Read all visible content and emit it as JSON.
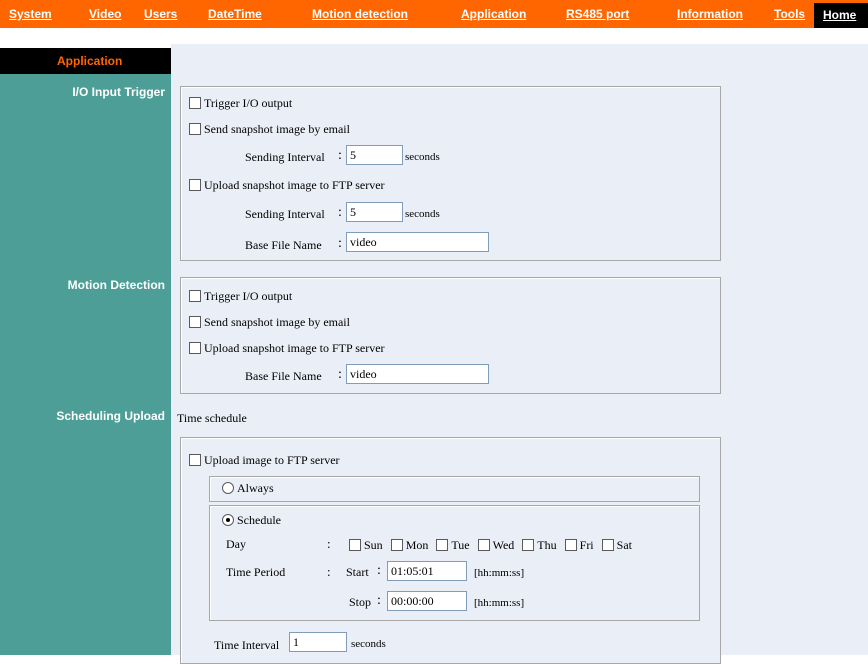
{
  "nav": {
    "items": [
      "System",
      "Video",
      "Users",
      "DateTime",
      "Motion detection",
      "Application",
      "RS485 port",
      "Information",
      "Tools"
    ],
    "home": "Home"
  },
  "sidebar": {
    "header": "Application",
    "sections": [
      "I/O Input Trigger",
      "Motion Detection",
      "Scheduling Upload"
    ]
  },
  "io_trigger": {
    "trigger_io": "Trigger I/O output",
    "send_email": "Send snapshot image by email",
    "sending_interval_label": "Sending Interval",
    "colon": ":",
    "email_interval": "5",
    "seconds": "seconds",
    "upload_ftp": "Upload snapshot image to FTP server",
    "ftp_interval": "5",
    "base_file_name_label": "Base File Name",
    "base_file_name": "video"
  },
  "motion": {
    "trigger_io": "Trigger I/O output",
    "send_email": "Send snapshot image by email",
    "upload_ftp": "Upload snapshot image to FTP server",
    "base_file_name_label": "Base File Name",
    "colon": ":",
    "base_file_name": "video"
  },
  "schedule": {
    "time_schedule": "Time schedule",
    "upload_ftp": "Upload image to FTP server",
    "always": "Always",
    "schedule": "Schedule",
    "day_label": "Day",
    "colon": ":",
    "days": [
      "Sun",
      "Mon",
      "Tue",
      "Wed",
      "Thu",
      "Fri",
      "Sat"
    ],
    "time_period_label": "Time Period",
    "start_label": "Start",
    "start_value": "01:05:01",
    "stop_label": "Stop",
    "stop_value": "00:00:00",
    "format_hint": "[hh:mm:ss]",
    "time_interval_label": "Time Interval",
    "time_interval_value": "1",
    "seconds": "seconds"
  }
}
